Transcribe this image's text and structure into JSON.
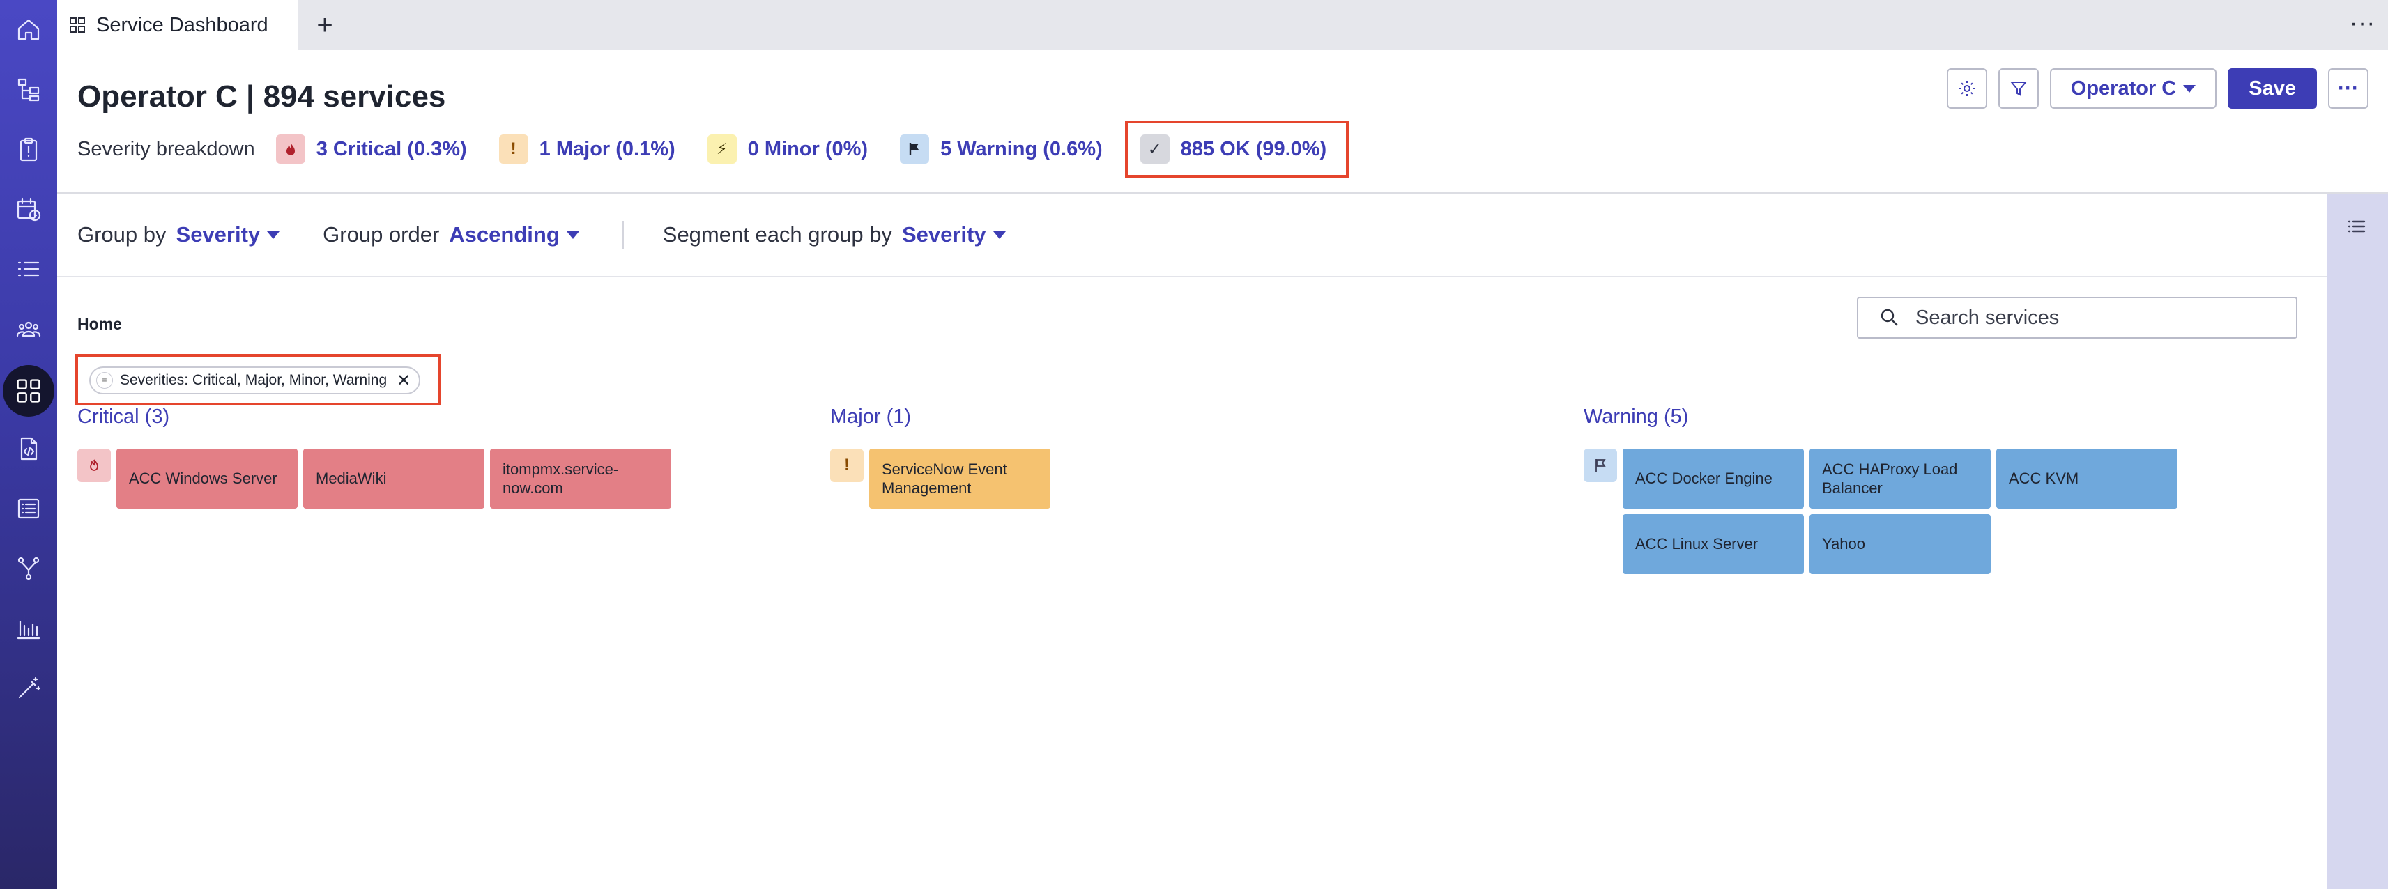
{
  "tab": {
    "label": "Service Dashboard",
    "add": "+",
    "more": "···"
  },
  "header": {
    "title": "Operator C | 894 services",
    "breakdown_label": "Severity breakdown",
    "severities": [
      {
        "key": "critical",
        "text": "3 Critical (0.3%)",
        "icon": "flame-icon",
        "bg": "#f3c4c7",
        "fg": "#b0212c"
      },
      {
        "key": "major",
        "text": "1 Major (0.1%)",
        "icon": "exclamation-icon",
        "glyph": "!",
        "bg": "#fbe0b8",
        "fg": "#8a4b00"
      },
      {
        "key": "minor",
        "text": "0 Minor (0%)",
        "icon": "lightning-icon",
        "glyph": "⚡",
        "bg": "#fbf1b0",
        "fg": "#6a5a00"
      },
      {
        "key": "warning",
        "text": "5 Warning (0.6%)",
        "icon": "flag-icon",
        "bg": "#c6dcf3",
        "fg": "#1f2430"
      },
      {
        "key": "ok",
        "text": "885 OK (99.0%)",
        "icon": "checkmark-icon",
        "glyph": "✓",
        "bg": "#d7d8de",
        "fg": "#2e3240"
      }
    ],
    "operator_label": "Operator C",
    "save_label": "Save",
    "more_label": "···"
  },
  "toolbar": {
    "group_by_label": "Group by",
    "group_by_value": "Severity",
    "group_order_label": "Group order",
    "group_order_value": "Ascending",
    "segment_label": "Segment each group by",
    "segment_value": "Severity"
  },
  "breadcrumb": "Home",
  "search": {
    "placeholder": "Search services"
  },
  "filter_chip": {
    "icon_glyph": "≡",
    "text": "Severities: Critical, Major, Minor, Warning",
    "close": "✕"
  },
  "groups": [
    {
      "title": "Critical (3)",
      "type": "critical",
      "icon_bg": "#f3c4c7",
      "items": [
        "ACC Windows Server",
        "MediaWiki",
        "itompmx.service-now.com"
      ]
    },
    {
      "title": "Major (1)",
      "type": "major",
      "icon_bg": "#fbe0b8",
      "icon_glyph": "!",
      "items": [
        "ServiceNow Event Management"
      ]
    },
    {
      "title": "Warning (5)",
      "type": "warning",
      "icon_bg": "#c6dcf3",
      "items": [
        "ACC Docker Engine",
        "ACC HAProxy Load Balancer",
        "ACC KVM",
        "ACC Linux Server",
        "Yahoo"
      ]
    }
  ],
  "colors": {
    "accent": "#3d3db5",
    "critical": "#e37f86",
    "major": "#f5c270",
    "warning": "#6fa8dc",
    "highlight": "#e5452d"
  }
}
